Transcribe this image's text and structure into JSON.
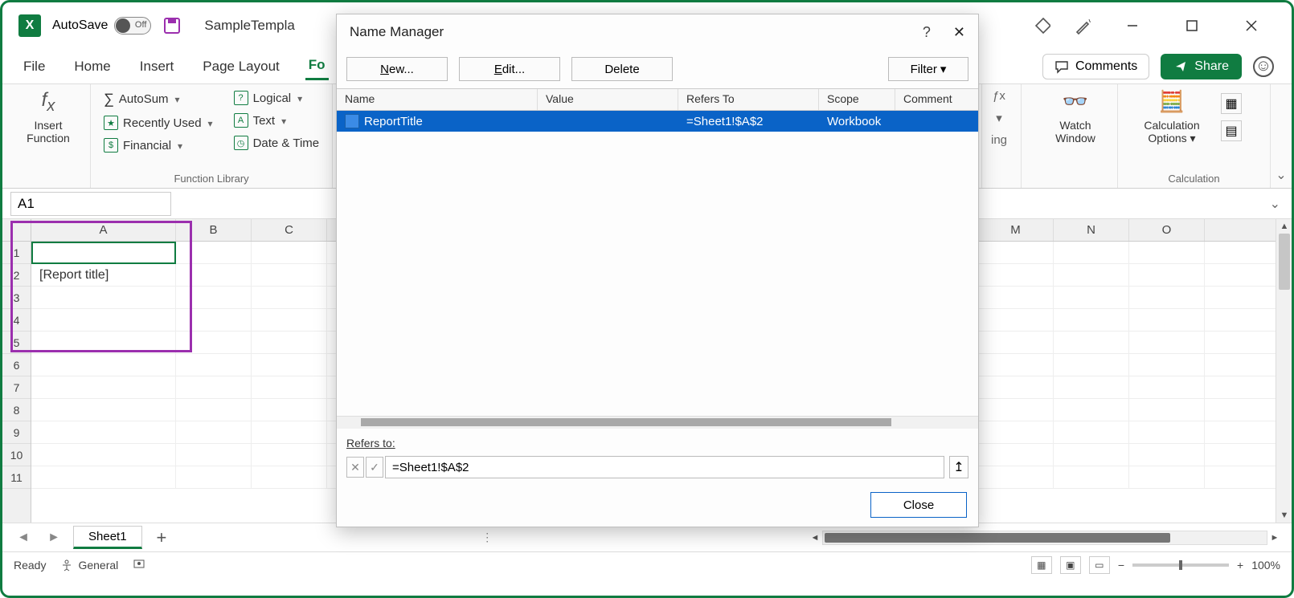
{
  "titlebar": {
    "autosave_label": "AutoSave",
    "autosave_state": "Off",
    "doc_title": "SampleTempla"
  },
  "tabs": {
    "file": "File",
    "home": "Home",
    "insert": "Insert",
    "page_layout": "Page Layout",
    "formulas_partial": "Fo",
    "comments": "Comments",
    "share": "Share"
  },
  "ribbon": {
    "insert_function": "Insert\nFunction",
    "autosum": "AutoSum",
    "recently_used": "Recently Used",
    "financial": "Financial",
    "logical": "Logical",
    "text": "Text",
    "date_time": "Date & Time",
    "function_library": "Function Library",
    "obscured_suffix": "ing",
    "watch_window": "Watch\nWindow",
    "calculation_options": "Calculation\nOptions",
    "calculation": "Calculation"
  },
  "namebox": {
    "value": "A1"
  },
  "grid": {
    "columns": [
      "A",
      "B",
      "C",
      "",
      "M",
      "N",
      "O"
    ],
    "rows": [
      "1",
      "2",
      "3",
      "4",
      "5",
      "6",
      "7",
      "8",
      "9",
      "10",
      "11"
    ],
    "a2_value": "[Report title]"
  },
  "sheetrow": {
    "sheet1": "Sheet1"
  },
  "statusbar": {
    "ready": "Ready",
    "accessibility": "General",
    "zoom": "100%"
  },
  "dialog": {
    "title": "Name Manager",
    "new_btn": "New...",
    "edit_btn": "Edit...",
    "delete_btn": "Delete",
    "filter_btn": "Filter",
    "headers": {
      "name": "Name",
      "value": "Value",
      "refers": "Refers To",
      "scope": "Scope",
      "comment": "Comment"
    },
    "row": {
      "name": "ReportTitle",
      "value": "",
      "refers": "=Sheet1!$A$2",
      "scope": "Workbook",
      "comment": ""
    },
    "refers_label": "Refers to:",
    "refers_value": "=Sheet1!$A$2",
    "close": "Close"
  }
}
